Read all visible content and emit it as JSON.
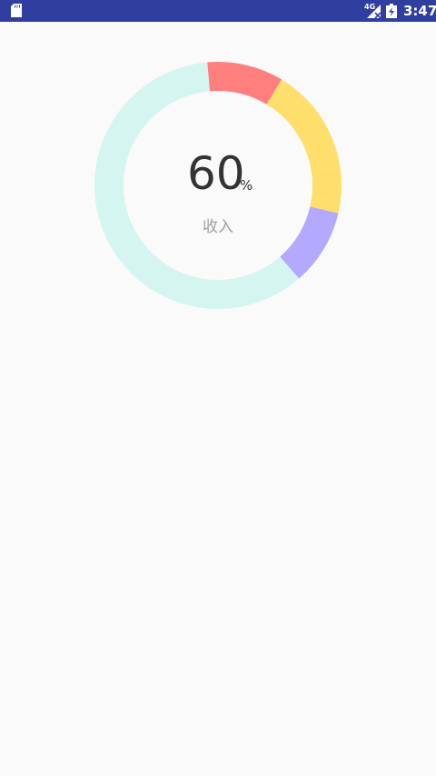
{
  "status_bar": {
    "network_type": "4G",
    "time": "3:47",
    "icons": [
      "sd-card-icon",
      "signal-icon",
      "battery-charging-icon"
    ]
  },
  "chart_data": {
    "type": "pie",
    "style": "donut",
    "center_value": "60",
    "center_unit": "%",
    "center_label": "收入",
    "start_angle_deg": 265,
    "slices": [
      {
        "value": 10,
        "color": "#ff7f7f"
      },
      {
        "value": 20,
        "color": "#ffdf6b"
      },
      {
        "value": 10,
        "color": "#b3aaff"
      },
      {
        "value": 60,
        "color": "#d5f5f0"
      }
    ]
  }
}
